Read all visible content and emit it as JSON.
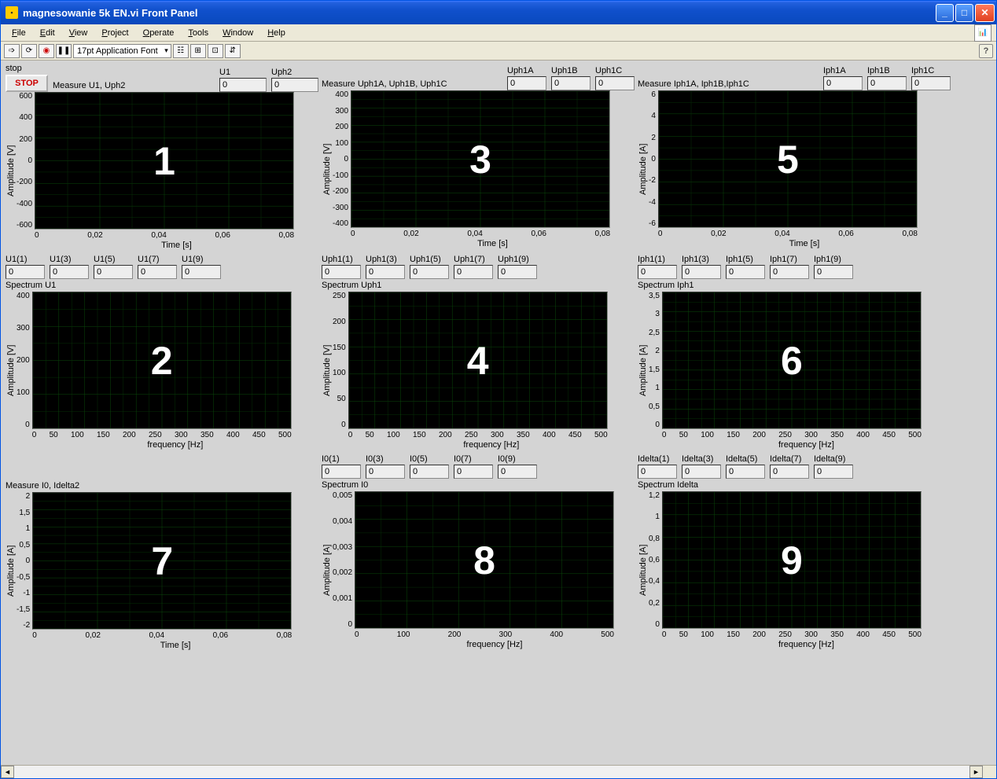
{
  "window": {
    "title": "magnesowanie 5k EN.vi Front Panel"
  },
  "menu": {
    "file": "File",
    "edit": "Edit",
    "view": "View",
    "project": "Project",
    "operate": "Operate",
    "tools": "Tools",
    "window": "Window",
    "help": "Help"
  },
  "toolbar": {
    "font": "17pt Application Font"
  },
  "stop": {
    "label": "stop",
    "button": "STOP"
  },
  "inputs": {
    "U1": {
      "label": "U1",
      "value": "0"
    },
    "Uph2": {
      "label": "Uph2",
      "value": "0"
    },
    "Uph1A": {
      "label": "Uph1A",
      "value": "0"
    },
    "Uph1B": {
      "label": "Uph1B",
      "value": "0"
    },
    "Uph1C": {
      "label": "Uph1C",
      "value": "0"
    },
    "Iph1A": {
      "label": "Iph1A",
      "value": "0"
    },
    "Iph1B": {
      "label": "Iph1B",
      "value": "0"
    },
    "Iph1C": {
      "label": "Iph1C",
      "value": "0"
    },
    "U1_1": {
      "label": "U1(1)",
      "value": "0"
    },
    "U1_3": {
      "label": "U1(3)",
      "value": "0"
    },
    "U1_5": {
      "label": "U1(5)",
      "value": "0"
    },
    "U1_7": {
      "label": "U1(7)",
      "value": "0"
    },
    "U1_9": {
      "label": "U1(9)",
      "value": "0"
    },
    "Uph1_1": {
      "label": "Uph1(1)",
      "value": "0"
    },
    "Uph1_3": {
      "label": "Uph1(3)",
      "value": "0"
    },
    "Uph1_5": {
      "label": "Uph1(5)",
      "value": "0"
    },
    "Uph1_7": {
      "label": "Uph1(7)",
      "value": "0"
    },
    "Uph1_9": {
      "label": "Uph1(9)",
      "value": "0"
    },
    "Iph1_1": {
      "label": "Iph1(1)",
      "value": "0"
    },
    "Iph1_3": {
      "label": "Iph1(3)",
      "value": "0"
    },
    "Iph1_5": {
      "label": "Iph1(5)",
      "value": "0"
    },
    "Iph1_7": {
      "label": "Iph1(7)",
      "value": "0"
    },
    "Iph1_9": {
      "label": "Iph1(9)",
      "value": "0"
    },
    "I0_1": {
      "label": "I0(1)",
      "value": "0"
    },
    "I0_3": {
      "label": "I0(3)",
      "value": "0"
    },
    "I0_5": {
      "label": "I0(5)",
      "value": "0"
    },
    "I0_7": {
      "label": "I0(7)",
      "value": "0"
    },
    "I0_9": {
      "label": "I0(9)",
      "value": "0"
    },
    "Idelta_1": {
      "label": "Idelta(1)",
      "value": "0"
    },
    "Idelta_3": {
      "label": "Idelta(3)",
      "value": "0"
    },
    "Idelta_5": {
      "label": "Idelta(5)",
      "value": "0"
    },
    "Idelta_7": {
      "label": "Idelta(7)",
      "value": "0"
    },
    "Idelta_9": {
      "label": "Idelta(9)",
      "value": "0"
    }
  },
  "charts": {
    "c1": {
      "title": "Measure U1, Uph2",
      "overlay": "1",
      "xlabel": "Time [s]",
      "ylabel": "Amplitude [V]",
      "xticks": [
        "0",
        "0,02",
        "0,04",
        "0,06",
        "0,08"
      ],
      "yticks": [
        "600",
        "400",
        "200",
        "0",
        "-200",
        "-400",
        "-600"
      ]
    },
    "c2": {
      "title": "Spectrum U1",
      "overlay": "2",
      "xlabel": "frequency [Hz]",
      "ylabel": "Amplitude [V]",
      "xticks": [
        "0",
        "50",
        "100",
        "150",
        "200",
        "250",
        "300",
        "350",
        "400",
        "450",
        "500"
      ],
      "yticks": [
        "400",
        "300",
        "200",
        "100",
        "0"
      ]
    },
    "c3": {
      "title": "Measure Uph1A, Uph1B, Uph1C",
      "overlay": "3",
      "xlabel": "Time [s]",
      "ylabel": "Amplitude [V]",
      "xticks": [
        "0",
        "0,02",
        "0,04",
        "0,06",
        "0,08"
      ],
      "yticks": [
        "400",
        "300",
        "200",
        "100",
        "0",
        "-100",
        "-200",
        "-300",
        "-400"
      ]
    },
    "c4": {
      "title": "Spectrum Uph1",
      "overlay": "4",
      "xlabel": "frequency [Hz]",
      "ylabel": "Amplitude [V]",
      "xticks": [
        "0",
        "50",
        "100",
        "150",
        "200",
        "250",
        "300",
        "350",
        "400",
        "450",
        "500"
      ],
      "yticks": [
        "250",
        "200",
        "150",
        "100",
        "50",
        "0"
      ]
    },
    "c5": {
      "title": "Measure Iph1A, Iph1B,Iph1C",
      "overlay": "5",
      "xlabel": "Time [s]",
      "ylabel": "Amplitude [A]",
      "xticks": [
        "0",
        "0,02",
        "0,04",
        "0,06",
        "0,08"
      ],
      "yticks": [
        "6",
        "4",
        "2",
        "0",
        "-2",
        "-4",
        "-6"
      ]
    },
    "c6": {
      "title": "Spectrum Iph1",
      "overlay": "6",
      "xlabel": "frequency [Hz]",
      "ylabel": "Amplitude [A]",
      "xticks": [
        "0",
        "50",
        "100",
        "150",
        "200",
        "250",
        "300",
        "350",
        "400",
        "450",
        "500"
      ],
      "yticks": [
        "3,5",
        "3",
        "2,5",
        "2",
        "1,5",
        "1",
        "0,5",
        "0"
      ]
    },
    "c7": {
      "title": "Measure I0, Idelta2",
      "overlay": "7",
      "xlabel": "Time [s]",
      "ylabel": "Amplitude [A]",
      "xticks": [
        "0",
        "0,02",
        "0,04",
        "0,06",
        "0,08"
      ],
      "yticks": [
        "2",
        "1,5",
        "1",
        "0,5",
        "0",
        "-0,5",
        "-1",
        "-1,5",
        "-2"
      ]
    },
    "c8": {
      "title": "Spectrum I0",
      "overlay": "8",
      "xlabel": "frequency [Hz]",
      "ylabel": "Amplitude [A]",
      "xticks": [
        "0",
        "100",
        "200",
        "300",
        "400",
        "500"
      ],
      "yticks": [
        "0,005",
        "0,004",
        "0,003",
        "0,002",
        "0,001",
        "0"
      ]
    },
    "c9": {
      "title": "Spectrum Idelta",
      "overlay": "9",
      "xlabel": "frequency [Hz]",
      "ylabel": "Amplitude [A]",
      "xticks": [
        "0",
        "50",
        "100",
        "150",
        "200",
        "250",
        "300",
        "350",
        "400",
        "450",
        "500"
      ],
      "yticks": [
        "1,2",
        "1",
        "0,8",
        "0,6",
        "0,4",
        "0,2",
        "0"
      ]
    }
  },
  "chart_data": [
    {
      "id": "c1",
      "type": "line",
      "title": "Measure U1, Uph2",
      "xlabel": "Time [s]",
      "ylabel": "Amplitude [V]",
      "xlim": [
        0,
        0.08
      ],
      "ylim": [
        -600,
        600
      ],
      "series": []
    },
    {
      "id": "c2",
      "type": "line",
      "title": "Spectrum U1",
      "xlabel": "frequency [Hz]",
      "ylabel": "Amplitude [V]",
      "xlim": [
        0,
        500
      ],
      "ylim": [
        0,
        400
      ],
      "series": []
    },
    {
      "id": "c3",
      "type": "line",
      "title": "Measure Uph1A, Uph1B, Uph1C",
      "xlabel": "Time [s]",
      "ylabel": "Amplitude [V]",
      "xlim": [
        0,
        0.08
      ],
      "ylim": [
        -400,
        400
      ],
      "series": []
    },
    {
      "id": "c4",
      "type": "line",
      "title": "Spectrum Uph1",
      "xlabel": "frequency [Hz]",
      "ylabel": "Amplitude [V]",
      "xlim": [
        0,
        500
      ],
      "ylim": [
        0,
        250
      ],
      "series": []
    },
    {
      "id": "c5",
      "type": "line",
      "title": "Measure Iph1A, Iph1B, Iph1C",
      "xlabel": "Time [s]",
      "ylabel": "Amplitude [A]",
      "xlim": [
        0,
        0.08
      ],
      "ylim": [
        -6,
        6
      ],
      "series": []
    },
    {
      "id": "c6",
      "type": "line",
      "title": "Spectrum Iph1",
      "xlabel": "frequency [Hz]",
      "ylabel": "Amplitude [A]",
      "xlim": [
        0,
        500
      ],
      "ylim": [
        0,
        3.5
      ],
      "series": []
    },
    {
      "id": "c7",
      "type": "line",
      "title": "Measure I0, Idelta2",
      "xlabel": "Time [s]",
      "ylabel": "Amplitude [A]",
      "xlim": [
        0,
        0.08
      ],
      "ylim": [
        -2,
        2
      ],
      "series": []
    },
    {
      "id": "c8",
      "type": "line",
      "title": "Spectrum I0",
      "xlabel": "frequency [Hz]",
      "ylabel": "Amplitude [A]",
      "xlim": [
        0,
        500
      ],
      "ylim": [
        0,
        0.005
      ],
      "series": []
    },
    {
      "id": "c9",
      "type": "line",
      "title": "Spectrum Idelta",
      "xlabel": "frequency [Hz]",
      "ylabel": "Amplitude [A]",
      "xlim": [
        0,
        500
      ],
      "ylim": [
        0,
        1.2
      ],
      "series": []
    }
  ]
}
